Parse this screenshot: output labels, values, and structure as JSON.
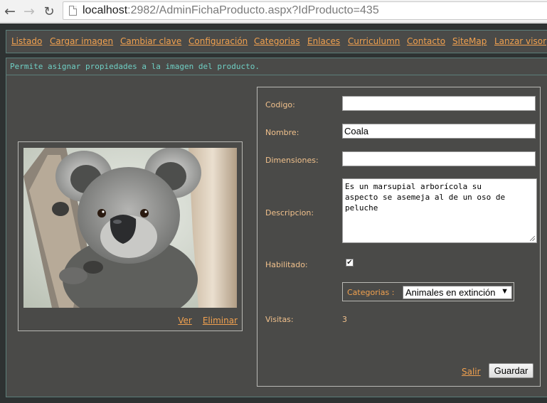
{
  "browser": {
    "url_host": "localhost",
    "url_rest": ":2982/AdminFichaProducto.aspx?IdProducto=435"
  },
  "menu": [
    {
      "label": "Listado"
    },
    {
      "label": "Cargar imagen"
    },
    {
      "label": "Cambiar clave"
    },
    {
      "label": "Configuración"
    },
    {
      "label": "Categorias"
    },
    {
      "label": "Enlaces"
    },
    {
      "label": "Curriculumn"
    },
    {
      "label": "Contacto"
    },
    {
      "label": "SiteMap"
    },
    {
      "label": "Lanzar visor"
    }
  ],
  "info": "Permite asignar propiedades a la imagen del producto.",
  "image_panel": {
    "ver_label": "Ver",
    "eliminar_label": "Eliminar"
  },
  "form": {
    "codigo_label": "Codigo:",
    "codigo_value": "",
    "nombre_label": "Nombre:",
    "nombre_value": "Coala",
    "dimensiones_label": "Dimensiones:",
    "dimensiones_value": "",
    "descripcion_label": "Descripcion:",
    "descripcion_value": "Es un marsupial arborícola su\naspecto se asemeja al de un oso de\npeluche",
    "habilitado_label": "Habilitado:",
    "habilitado_checked": true,
    "categorias_label": "Categorias :",
    "categorias_value": "Animales en extinción",
    "visitas_label": "Visitas:",
    "visitas_value": "3",
    "salir_label": "Salir",
    "guardar_label": "Guardar"
  },
  "colors": {
    "link": "#f1a14f",
    "label": "#f1c18c",
    "info": "#6fcfc4",
    "panel_bg": "#4a4a48"
  }
}
